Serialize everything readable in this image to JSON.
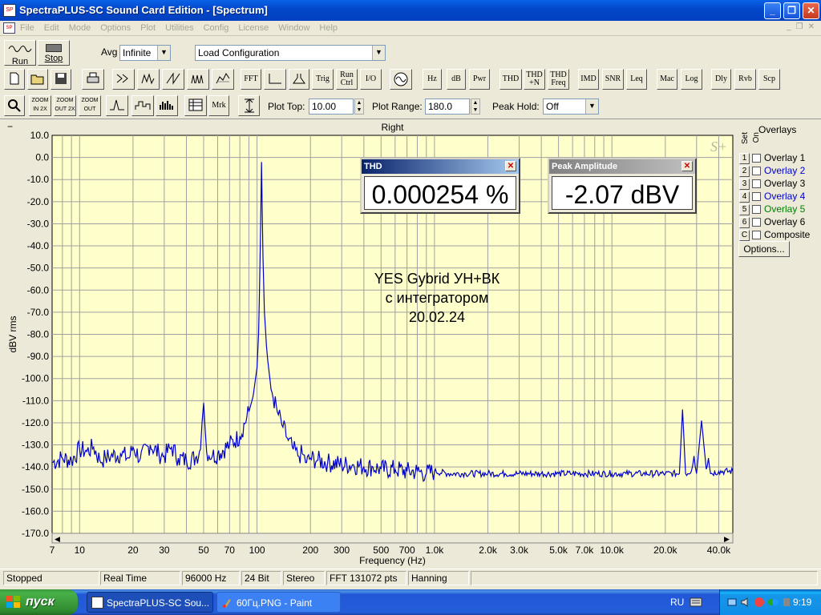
{
  "window": {
    "title": "SpectraPLUS-SC Sound Card Edition - [Spectrum]"
  },
  "menu": [
    "File",
    "Edit",
    "Mode",
    "Options",
    "Plot",
    "Utilities",
    "Config",
    "License",
    "Window",
    "Help"
  ],
  "toolbar1": {
    "run": "Run",
    "stop": "Stop",
    "avg_label": "Avg",
    "avg_value": "Infinite",
    "config_value": "Load Configuration"
  },
  "toolbar2": {
    "fft": "FFT",
    "trig": "Trig",
    "run_ctrl": "Run Ctrl",
    "io": "I/O",
    "hz": "Hz",
    "db": "dB",
    "pwr": "Pwr",
    "thd": "THD",
    "thdn": "THD +N",
    "thdfreq": "THD Freq",
    "imd": "IMD",
    "snr": "SNR",
    "leq": "Leq",
    "mac": "Mac",
    "log": "Log",
    "dly": "Dly",
    "rvb": "Rvb",
    "scp": "Scp"
  },
  "toolbar3": {
    "zoom_in": "ZOOM IN 2X",
    "zoom_out": "ZOOM OUT 2X",
    "zoom_full": "ZOOM OUT FULL",
    "mrk": "Mrk",
    "plot_top_label": "Plot Top:",
    "plot_top_value": "10.00",
    "plot_range_label": "Plot Range:",
    "plot_range_value": "180.0",
    "peak_hold_label": "Peak Hold:",
    "peak_hold_value": "Off"
  },
  "plot": {
    "channel": "Right",
    "collapse": "−",
    "expand": "+",
    "watermark": "S+",
    "annotation": [
      "YES Gybrid  УН+ВК",
      "с интегратором",
      "20.02.24"
    ]
  },
  "overlays": {
    "title": "Overlays",
    "set_label": "Set",
    "on_label": "On",
    "items": [
      {
        "num": "1",
        "label": "Overlay 1",
        "color": "#000000"
      },
      {
        "num": "2",
        "label": "Overlay 2",
        "color": "#0000cc"
      },
      {
        "num": "3",
        "label": "Overlay 3",
        "color": "#000000"
      },
      {
        "num": "4",
        "label": "Overlay 4",
        "color": "#0000cc"
      },
      {
        "num": "5",
        "label": "Overlay 5",
        "color": "#008000"
      },
      {
        "num": "6",
        "label": "Overlay 6",
        "color": "#000000"
      },
      {
        "num": "C",
        "label": "Composite",
        "color": "#000000"
      }
    ],
    "options_label": "Options..."
  },
  "meters": {
    "thd": {
      "title": "THD",
      "value": "0.000254 %"
    },
    "peak": {
      "title": "Peak Amplitude",
      "value": "-2.07 dBV"
    }
  },
  "status": {
    "state": "Stopped",
    "mode": "Real Time",
    "rate": "96000 Hz",
    "bits": "24 Bit",
    "channels": "Stereo",
    "fft": "FFT 131072 pts",
    "window": "Hanning"
  },
  "taskbar": {
    "start": "пуск",
    "tasks": [
      "SpectraPLUS-SC Sou...",
      "60Гц.PNG - Paint"
    ],
    "lang": "RU",
    "clock": "9:19"
  },
  "colors": {
    "plot_bg": "#ffffcc",
    "trace": "#0000cc",
    "grid": "#a0a0a0"
  },
  "chart_data": {
    "type": "line",
    "title": "Right",
    "xlabel": "Frequency (Hz)",
    "ylabel": "dBV rms",
    "xscale": "log",
    "xlim": [
      7,
      48000
    ],
    "ylim": [
      -170,
      10
    ],
    "grid": true,
    "yticks": [
      "10.0",
      "0.0",
      "-10.0",
      "-20.0",
      "-30.0",
      "-40.0",
      "-50.0",
      "-60.0",
      "-70.0",
      "-80.0",
      "-90.0",
      "-100.0",
      "-110.0",
      "-120.0",
      "-130.0",
      "-140.0",
      "-150.0",
      "-160.0",
      "-170.0"
    ],
    "xticks": [
      {
        "v": 7,
        "t": "7"
      },
      {
        "v": 10,
        "t": "10"
      },
      {
        "v": 20,
        "t": "20"
      },
      {
        "v": 30,
        "t": "30"
      },
      {
        "v": 50,
        "t": "50"
      },
      {
        "v": 70,
        "t": "70"
      },
      {
        "v": 100,
        "t": "100"
      },
      {
        "v": 200,
        "t": "200"
      },
      {
        "v": 300,
        "t": "300"
      },
      {
        "v": 500,
        "t": "500"
      },
      {
        "v": 700,
        "t": "700"
      },
      {
        "v": 1000,
        "t": "1.0k"
      },
      {
        "v": 2000,
        "t": "2.0k"
      },
      {
        "v": 3000,
        "t": "3.0k"
      },
      {
        "v": 5000,
        "t": "5.0k"
      },
      {
        "v": 7000,
        "t": "7.0k"
      },
      {
        "v": 10000,
        "t": "10.0k"
      },
      {
        "v": 20000,
        "t": "20.0k"
      },
      {
        "v": 40000,
        "t": "40.0k"
      }
    ],
    "series": [
      {
        "x": [
          7,
          8,
          9,
          10,
          11,
          12,
          13,
          14,
          15,
          17,
          19,
          20,
          22,
          25,
          28,
          30,
          33,
          36,
          40,
          45,
          48,
          49,
          50,
          51,
          52,
          56,
          60,
          70,
          80,
          90,
          95,
          98,
          100,
          102,
          103,
          104,
          105,
          106,
          107,
          108,
          110,
          113,
          115,
          120,
          130,
          140,
          150,
          160,
          170,
          180,
          190,
          200,
          220,
          250,
          300,
          350,
          400,
          450,
          500,
          600,
          700,
          800,
          900,
          1000,
          1200,
          1500,
          2000,
          2500,
          3000,
          4000,
          5000,
          6000,
          7000,
          8000,
          10000,
          12000,
          15000,
          20000,
          24000,
          25000,
          26000,
          28000,
          29000,
          30000,
          32000,
          34000,
          35000,
          36000,
          40000,
          48000
        ],
        "y": [
          -138,
          -136,
          -137,
          -132,
          -133,
          -131,
          -137,
          -136,
          -135,
          -134,
          -136,
          -131,
          -136,
          -130,
          -134,
          -135,
          -131,
          -136,
          -137,
          -136,
          -132,
          -120,
          -111,
          -123,
          -133,
          -135,
          -134,
          -130,
          -126,
          -115,
          -108,
          -100,
          -95,
          -80,
          -65,
          -45,
          -25,
          -2.1,
          -25,
          -45,
          -70,
          -85,
          -92,
          -105,
          -115,
          -122,
          -128,
          -132,
          -135,
          -134,
          -138,
          -136,
          -137,
          -138,
          -139,
          -139,
          -140,
          -140,
          -141,
          -141,
          -142,
          -142,
          -143,
          -142,
          -143,
          -143,
          -143,
          -143,
          -143,
          -143,
          -143,
          -143,
          -143,
          -143,
          -143,
          -143,
          -143,
          -143,
          -143,
          -114,
          -143,
          -142,
          -135,
          -143,
          -119,
          -141,
          -136,
          -143,
          -142,
          -142
        ]
      }
    ]
  }
}
